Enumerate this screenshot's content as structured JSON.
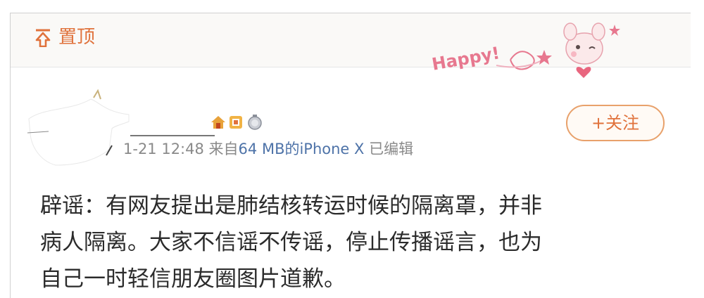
{
  "pin": {
    "label": "置顶"
  },
  "decoration": {
    "happy_text": "Happy!"
  },
  "post": {
    "time": "1-21 12:48",
    "source_prefix": "来自",
    "device": "64 MB的iPhone X",
    "edited": "已编辑",
    "follow_label": "+关注",
    "text_lines": [
      "辟谣：有网友提出是肺结核转运时候的隔离罩，并非",
      "病人隔离。大家不信谣不传谣，停止传播谣言，也为",
      "自己一时轻信朋友圈图片道歉。"
    ]
  },
  "colors": {
    "accent": "#e0723c",
    "link": "#4e73a8",
    "meta": "#8a8a8a",
    "text": "#2b2b2b"
  },
  "icons": [
    "pin-top-icon",
    "vip-house-icon",
    "verified-square-icon",
    "medal-icon"
  ]
}
